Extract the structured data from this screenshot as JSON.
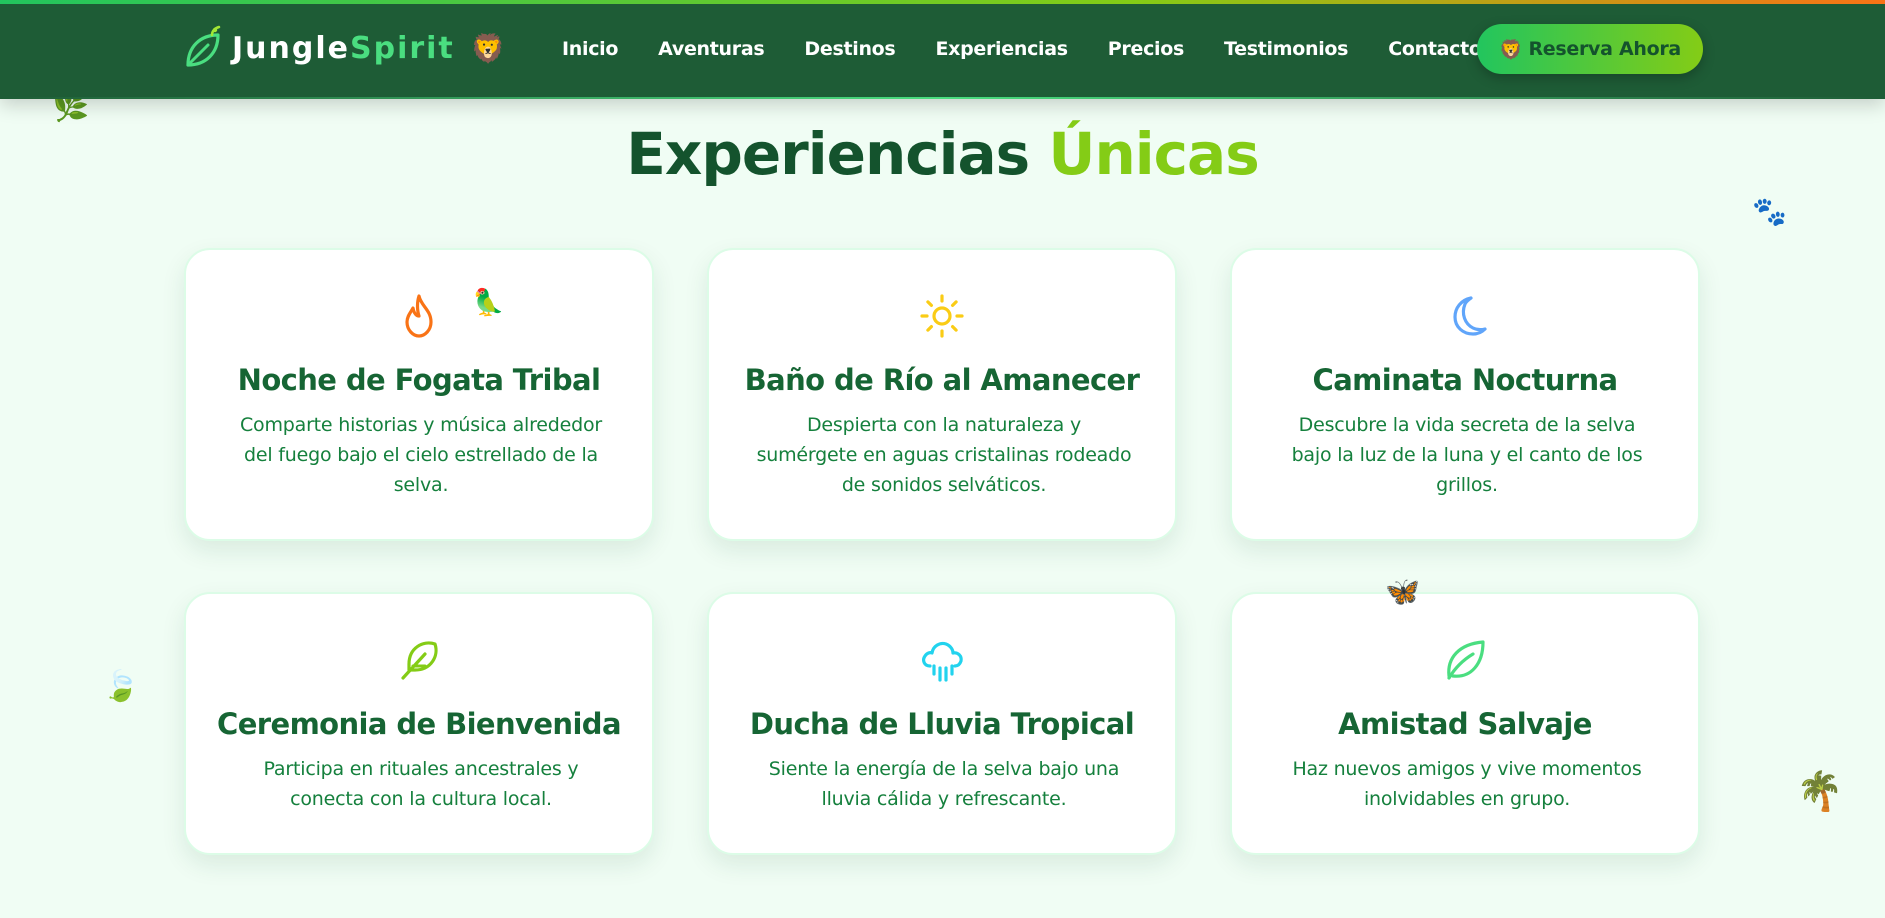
{
  "brand": {
    "name_part1": "Jungle",
    "name_part2": "Spirit",
    "emoji": "🦁"
  },
  "nav": {
    "items": [
      "Inicio",
      "Aventuras",
      "Destinos",
      "Experiencias",
      "Precios",
      "Testimonios",
      "Contacto"
    ]
  },
  "cta": {
    "emoji": "🦁",
    "label": "Reserva Ahora"
  },
  "section": {
    "title_part1": "Experiencias",
    "title_part2": "Únicas"
  },
  "cards": [
    {
      "icon": "flame-icon",
      "title": "Noche de Fogata Tribal",
      "description": "Comparte historias y música alrededor del fuego bajo el cielo estrellado de la selva."
    },
    {
      "icon": "sun-icon",
      "title": "Baño de Río al Amanecer",
      "description": "Despierta con la naturaleza y sumérgete en aguas cristalinas rodeado de sonidos selváticos."
    },
    {
      "icon": "moon-icon",
      "title": "Caminata Nocturna",
      "description": "Descubre la vida secreta de la selva bajo la luz de la luna y el canto de los grillos."
    },
    {
      "icon": "feather-icon",
      "title": "Ceremonia de Bienvenida",
      "description": "Participa en rituales ancestrales y conecta con la cultura local."
    },
    {
      "icon": "cloud-rain-icon",
      "title": "Ducha de Lluvia Tropical",
      "description": "Siente la energía de la selva bajo una lluvia cálida y refrescante."
    },
    {
      "icon": "leaf-icon",
      "title": "Amistad Salvaje",
      "description": "Haz nuevos amigos y vive momentos inolvidables en grupo."
    }
  ],
  "decorations": {
    "herb": "🌿",
    "paws": "🐾",
    "parrot": "🦜",
    "butterfly": "🦋",
    "leaves": "🍃",
    "palm": "🌴"
  },
  "colors": {
    "header_bg": "#1e5c36",
    "accent_green": "#4ade80",
    "accent_lime": "#84cc16",
    "title_dark": "#14532d",
    "card_title": "#166534",
    "card_text": "#15803d",
    "page_bg": "#f0fdf4",
    "flame": "#f97316",
    "sun": "#facc15",
    "moon": "#60a5fa",
    "feather": "#84cc16",
    "rain": "#22d3ee",
    "leaf": "#4ade80"
  }
}
